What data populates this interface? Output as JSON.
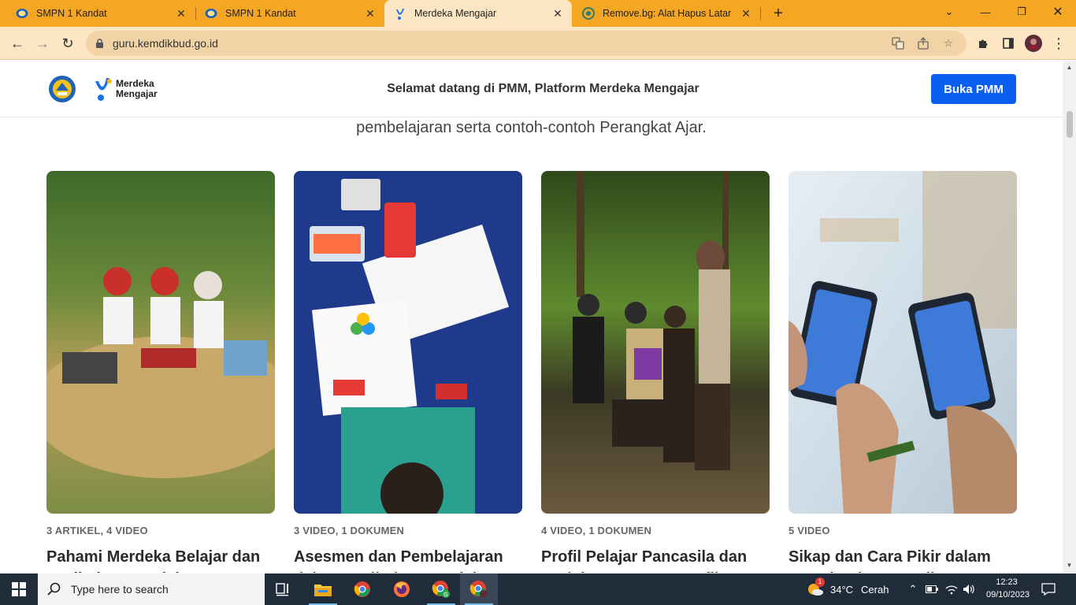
{
  "browser": {
    "tabs": [
      {
        "title": "SMPN 1 Kandat",
        "icon": "school-favicon"
      },
      {
        "title": "SMPN 1 Kandat",
        "icon": "school-favicon"
      },
      {
        "title": "Merdeka Mengajar",
        "icon": "merdeka-mengajar-favicon"
      },
      {
        "title": "Remove.bg: Alat Hapus Latar",
        "icon": "remove-bg-favicon"
      }
    ],
    "active_tab": 2,
    "url": "guru.kemdikbud.go.id"
  },
  "site": {
    "logo_text_line1": "Merdeka",
    "logo_text_line2": "Mengajar",
    "welcome": "Selamat datang di PMM, Platform Merdeka Mengajar",
    "cta_label": "Buka PMM",
    "cta_color": "#0b5ff0",
    "intro_text": "pembelajaran serta contoh-contoh Perangkat Ajar."
  },
  "cards": [
    {
      "meta": "3 ARTIKEL, 4 VIDEO",
      "title": "Pahami Merdeka Belajar dan Kurikulum Merdeka"
    },
    {
      "meta": "3 VIDEO, 1 DOKUMEN",
      "title": "Asesmen dan Pembelajaran dalam Kurikulum Merdeka"
    },
    {
      "meta": "4 VIDEO, 1 DOKUMEN",
      "title": "Profil Pelajar Pancasila dan Projek Penguatan Profil"
    },
    {
      "meta": "5 VIDEO",
      "title": "Sikap dan Cara Pikir dalam Mengimplementasikan"
    }
  ],
  "taskbar": {
    "search_placeholder": "Type here to search",
    "weather_temp": "34°C",
    "weather_text": "Cerah",
    "weather_badge": "1",
    "time": "12:23",
    "date": "09/10/2023"
  }
}
